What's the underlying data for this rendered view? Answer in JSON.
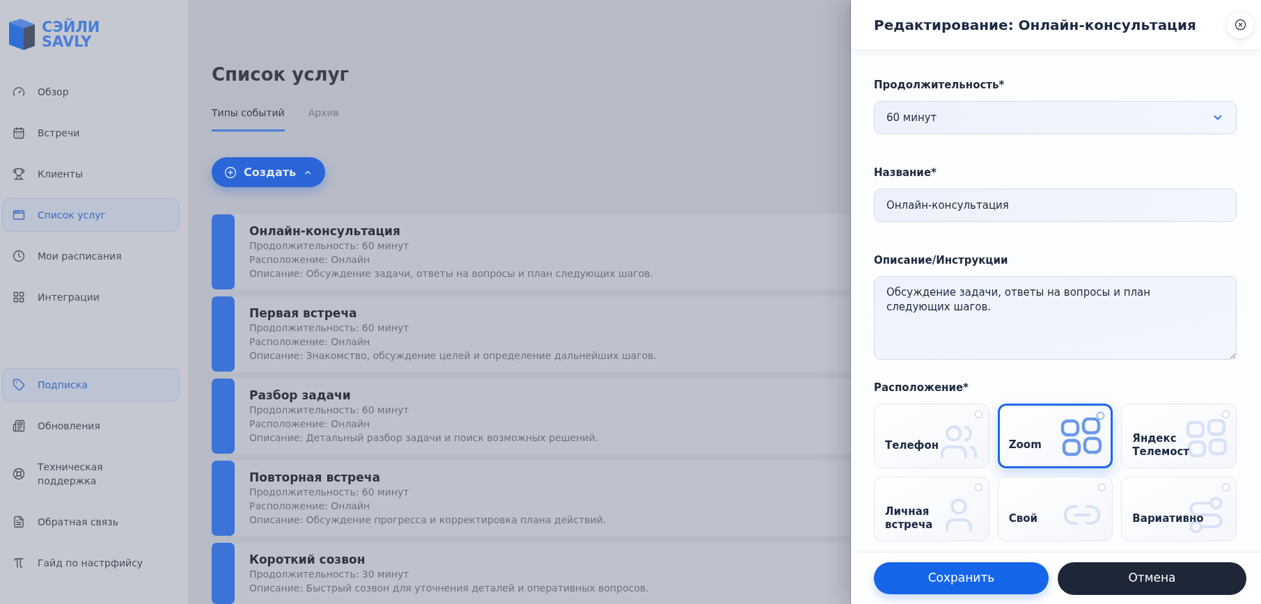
{
  "sidebar": {
    "logo": {
      "line_1": "СЭЙЛИ",
      "line_2": "SAVLY"
    },
    "items": [
      {
        "label": "Обзор",
        "selected": false
      },
      {
        "label": "Встречи",
        "selected": false
      },
      {
        "label": "Клиенты",
        "selected": false
      },
      {
        "label": "Список услуг",
        "selected": true
      },
      {
        "label": "Мои расписания",
        "selected": false
      },
      {
        "label": "Интеграции",
        "selected": false
      }
    ],
    "bottom_items": [
      {
        "label": "Подписка",
        "selected": true
      },
      {
        "label": "Обновления",
        "selected": false
      },
      {
        "label": "Техническая поддержка",
        "selected": false
      },
      {
        "label": "Обратная связь",
        "selected": false
      },
      {
        "label": "Гайд по настрфийсу",
        "selected": false
      }
    ]
  },
  "main": {
    "title": "Список услуг",
    "tabs": [
      {
        "label": "Типы событий",
        "selected": true
      },
      {
        "label": "Архив",
        "selected": false
      }
    ],
    "create_button": "Создать",
    "services": [
      {
        "title": "Онлайн-консультация",
        "details": [
          "Продолжительность: 60 минут",
          "Расположение: Онлайн",
          "Описание: Обсуждение задачи, ответы на вопросы и план следующих шагов."
        ]
      },
      {
        "title": "Первая встреча",
        "details": [
          "Продолжительность: 60 минут",
          "Расположение: Онлайн",
          "Описание: Знакомство, обсуждение целей и определение дальнейших шагов."
        ]
      },
      {
        "title": "Разбор задачи",
        "details": [
          "Продолжительность: 60 минут",
          "Расположение: Онлайн",
          "Описание: Детальный разбор задачи и поиск возможных решений."
        ]
      },
      {
        "title": "Повторная встреча",
        "details": [
          "Продолжительность: 60 минут",
          "Расположение: Онлайн",
          "Описание: Обсуждение прогресса и корректировка плана действий."
        ]
      },
      {
        "title": "Короткий созвон",
        "details": [
          "Продолжительность: 30 минут",
          "Описание: Быстрый созвон для уточнения деталей и оперативных вопросов."
        ]
      }
    ]
  },
  "edit_panel": {
    "title": "Редактирование: Онлайн-консультация",
    "fields": [
      {
        "kind": "select",
        "label": "Продолжительность*",
        "value": "60 минут"
      },
      {
        "kind": "input",
        "label": "Название*",
        "value": "Онлайн-консультация"
      },
      {
        "kind": "textarea",
        "label": "Описание/Инструкции",
        "value": "Обсуждение задачи, ответы на вопросы и план следующих шагов."
      }
    ],
    "location": {
      "label": "Расположение*",
      "options": [
        {
          "label": "Телефон",
          "selected": false
        },
        {
          "label": "Zoom",
          "selected": true
        },
        {
          "label": "Яндекс Телемост",
          "selected": false
        },
        {
          "label": "Личная встреча",
          "selected": false
        },
        {
          "label": "Свой",
          "selected": false
        },
        {
          "label": "Вариативно",
          "selected": false
        }
      ]
    },
    "save_button": "Сохранить",
    "cancel_button": "Отмена"
  }
}
